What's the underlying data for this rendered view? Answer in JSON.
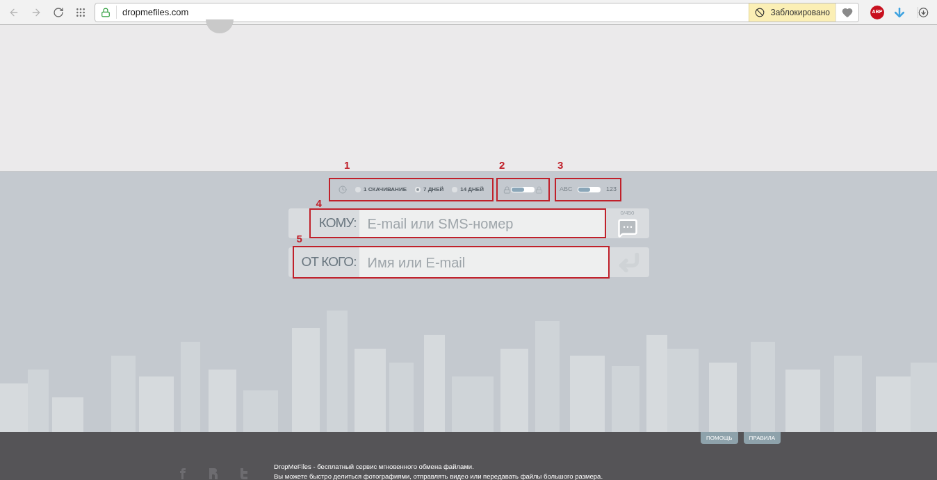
{
  "browser": {
    "url": "dropmefiles.com",
    "blocked_label": "Заблокировано",
    "extension_badge": "ABP"
  },
  "expiry": {
    "number": "1",
    "options": [
      {
        "label": "1 СКАЧИВАНИЕ",
        "selected": false
      },
      {
        "label": "7 ДНЕЙ",
        "selected": true
      },
      {
        "label": "14 ДНЕЙ",
        "selected": false
      }
    ]
  },
  "password": {
    "number": "2",
    "level": 0.55
  },
  "text_mode": {
    "number": "3",
    "left_label": "ABC",
    "right_label": "123",
    "level": 0.55
  },
  "recipient": {
    "number": "4",
    "label": "КОМУ:",
    "placeholder": "E-mail или SMS-номер",
    "counter": "0/450"
  },
  "sender": {
    "number": "5",
    "label": "ОТ КОГО:",
    "placeholder": "Имя или E-mail"
  },
  "footer": {
    "buttons": [
      "ПОМОЩЬ",
      "ПРАВИЛА"
    ],
    "lines": [
      "DropMeFiles - бесплатный сервис мгновенного обмена файлами.",
      "Вы можете быстро делиться фотографиями, отправлять видео или передавать файлы большого размера."
    ]
  }
}
